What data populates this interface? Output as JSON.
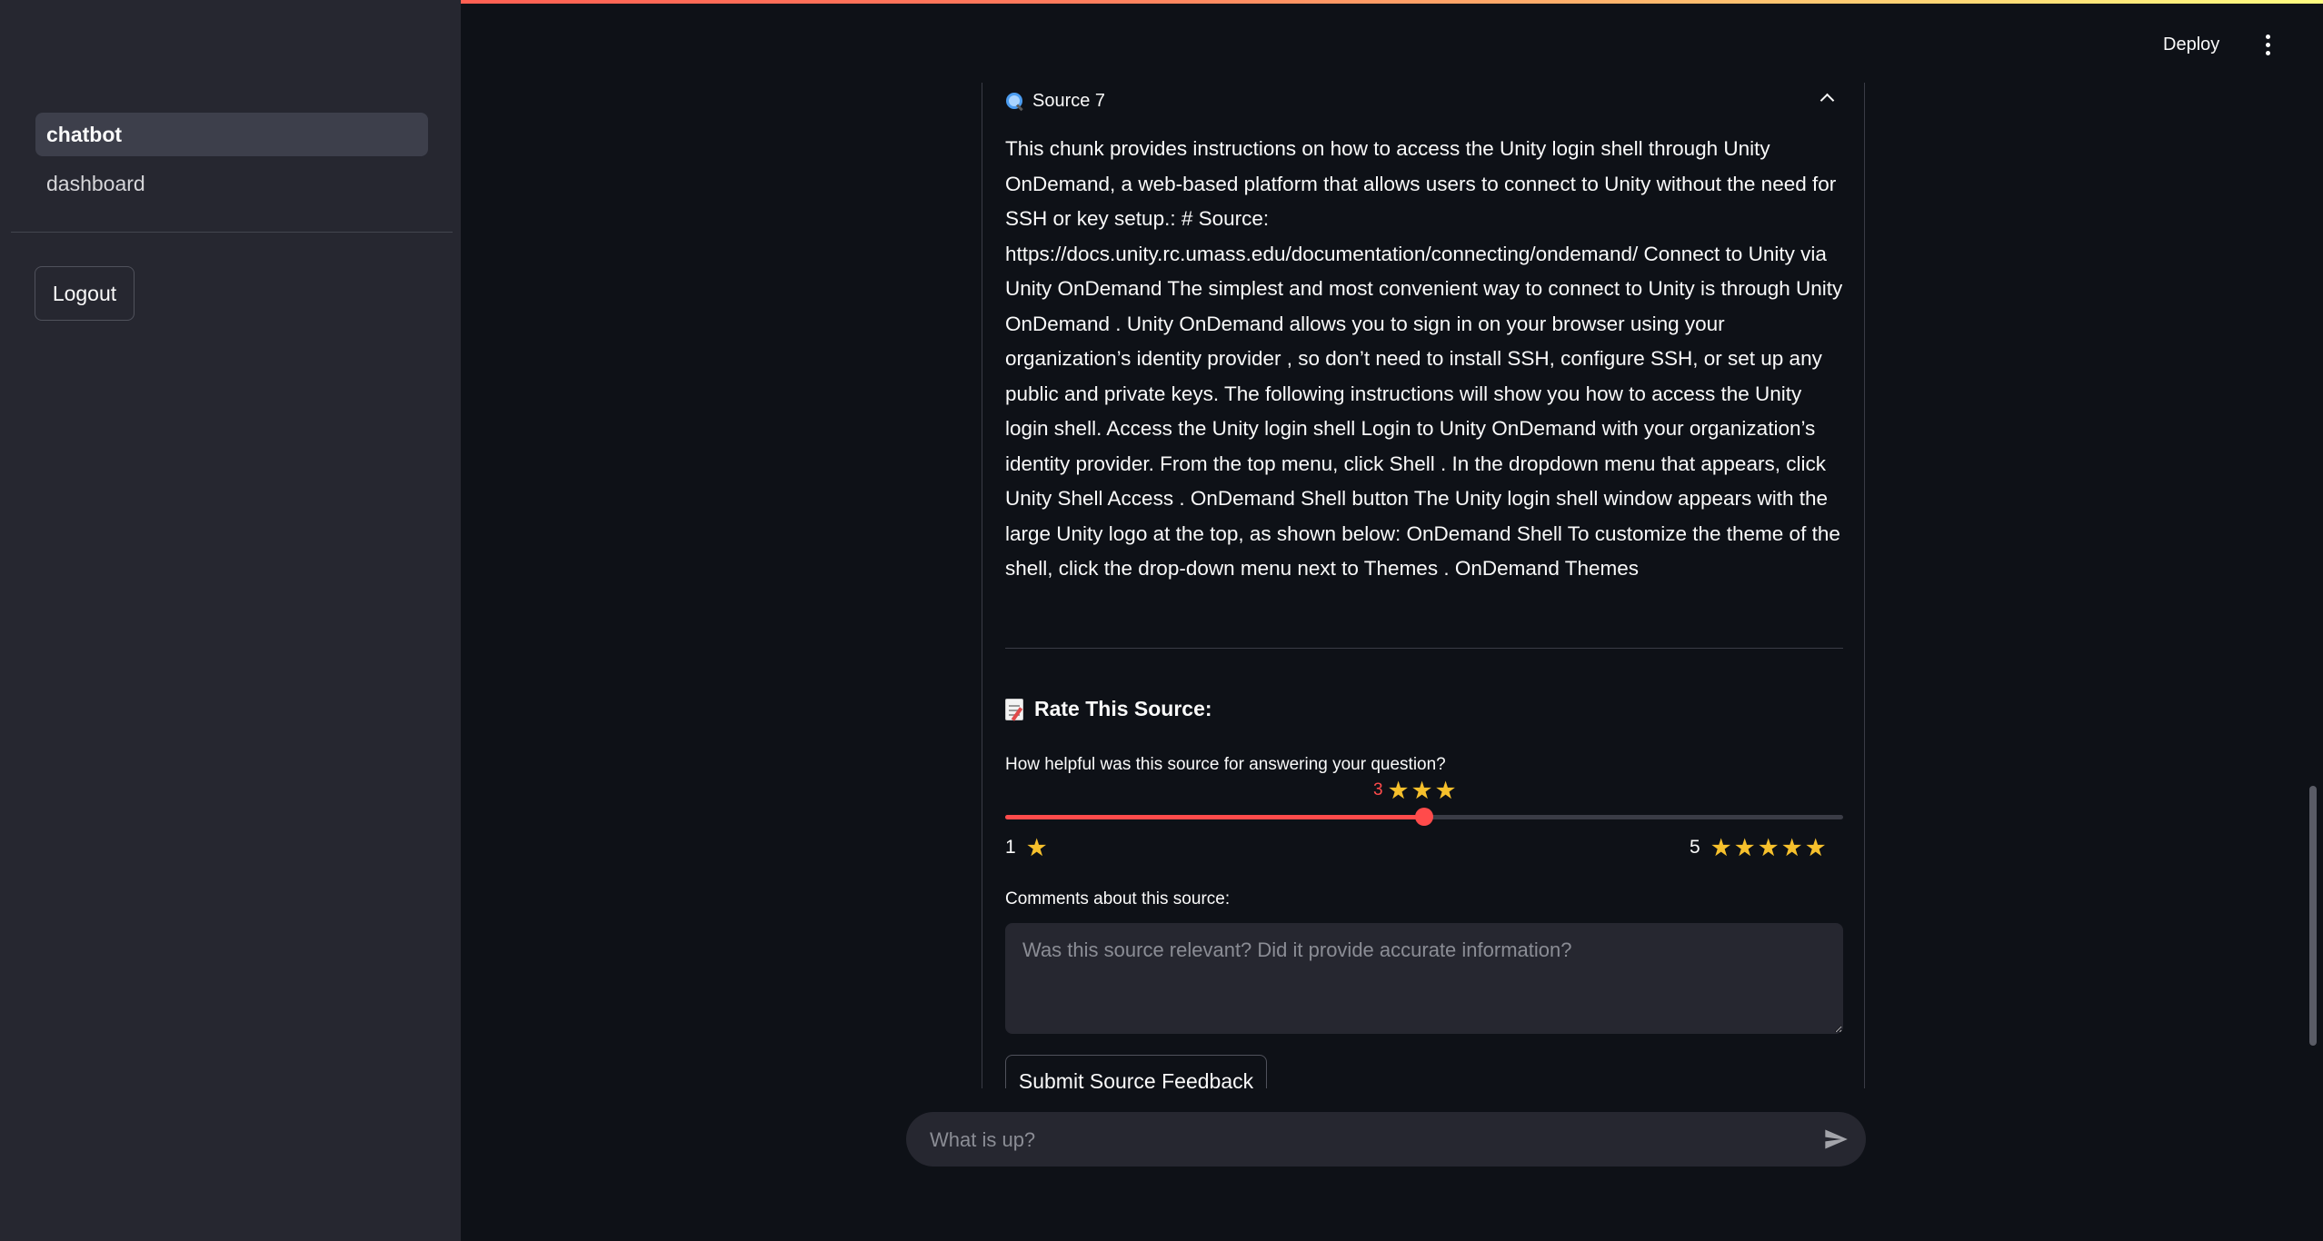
{
  "sidebar": {
    "items": [
      {
        "label": "chatbot",
        "active": true
      },
      {
        "label": "dashboard",
        "active": false
      }
    ],
    "logout_label": "Logout"
  },
  "header": {
    "deploy_label": "Deploy",
    "menu_icon": "kebab-menu-icon"
  },
  "source": {
    "title": "Source 7",
    "icon": "magnifying-glass-icon",
    "expanded": true,
    "text": "This chunk provides instructions on how to access the Unity login shell through Unity OnDemand, a web-based platform that allows users to connect to Unity without the need for SSH or key setup.: # Source: https://docs.unity.rc.umass.edu/documentation/connecting/ondemand/ Connect to Unity via Unity OnDemand The simplest and most convenient way to connect to Unity is through Unity OnDemand . Unity OnDemand allows you to sign in on your browser using your organization’s identity provider , so don’t need to install SSH, configure SSH, or set up any public and private keys. The following instructions will show you how to access the Unity login shell. Access the Unity login shell Login to Unity OnDemand with your organization’s identity provider. From the top menu, click Shell . In the dropdown menu that appears, click Unity Shell Access . OnDemand Shell button The Unity login shell window appears with the large Unity logo at the top, as shown below: OnDemand Shell To customize the theme of the shell, click the drop-down menu next to Themes . OnDemand Themes"
  },
  "rating": {
    "heading": "Rate This Source:",
    "question": "How helpful was this source for answering your question?",
    "min": 1,
    "max": 5,
    "value": 3,
    "value_label": "3",
    "min_label": "1",
    "max_label": "5",
    "accent": "#ff4b4b",
    "star_color": "#f6c02c"
  },
  "comments": {
    "label": "Comments about this source:",
    "placeholder": "Was this source relevant? Did it provide accurate information?",
    "value": ""
  },
  "submit_label": "Submit Source Feedback",
  "chat": {
    "placeholder": "What is up?"
  }
}
